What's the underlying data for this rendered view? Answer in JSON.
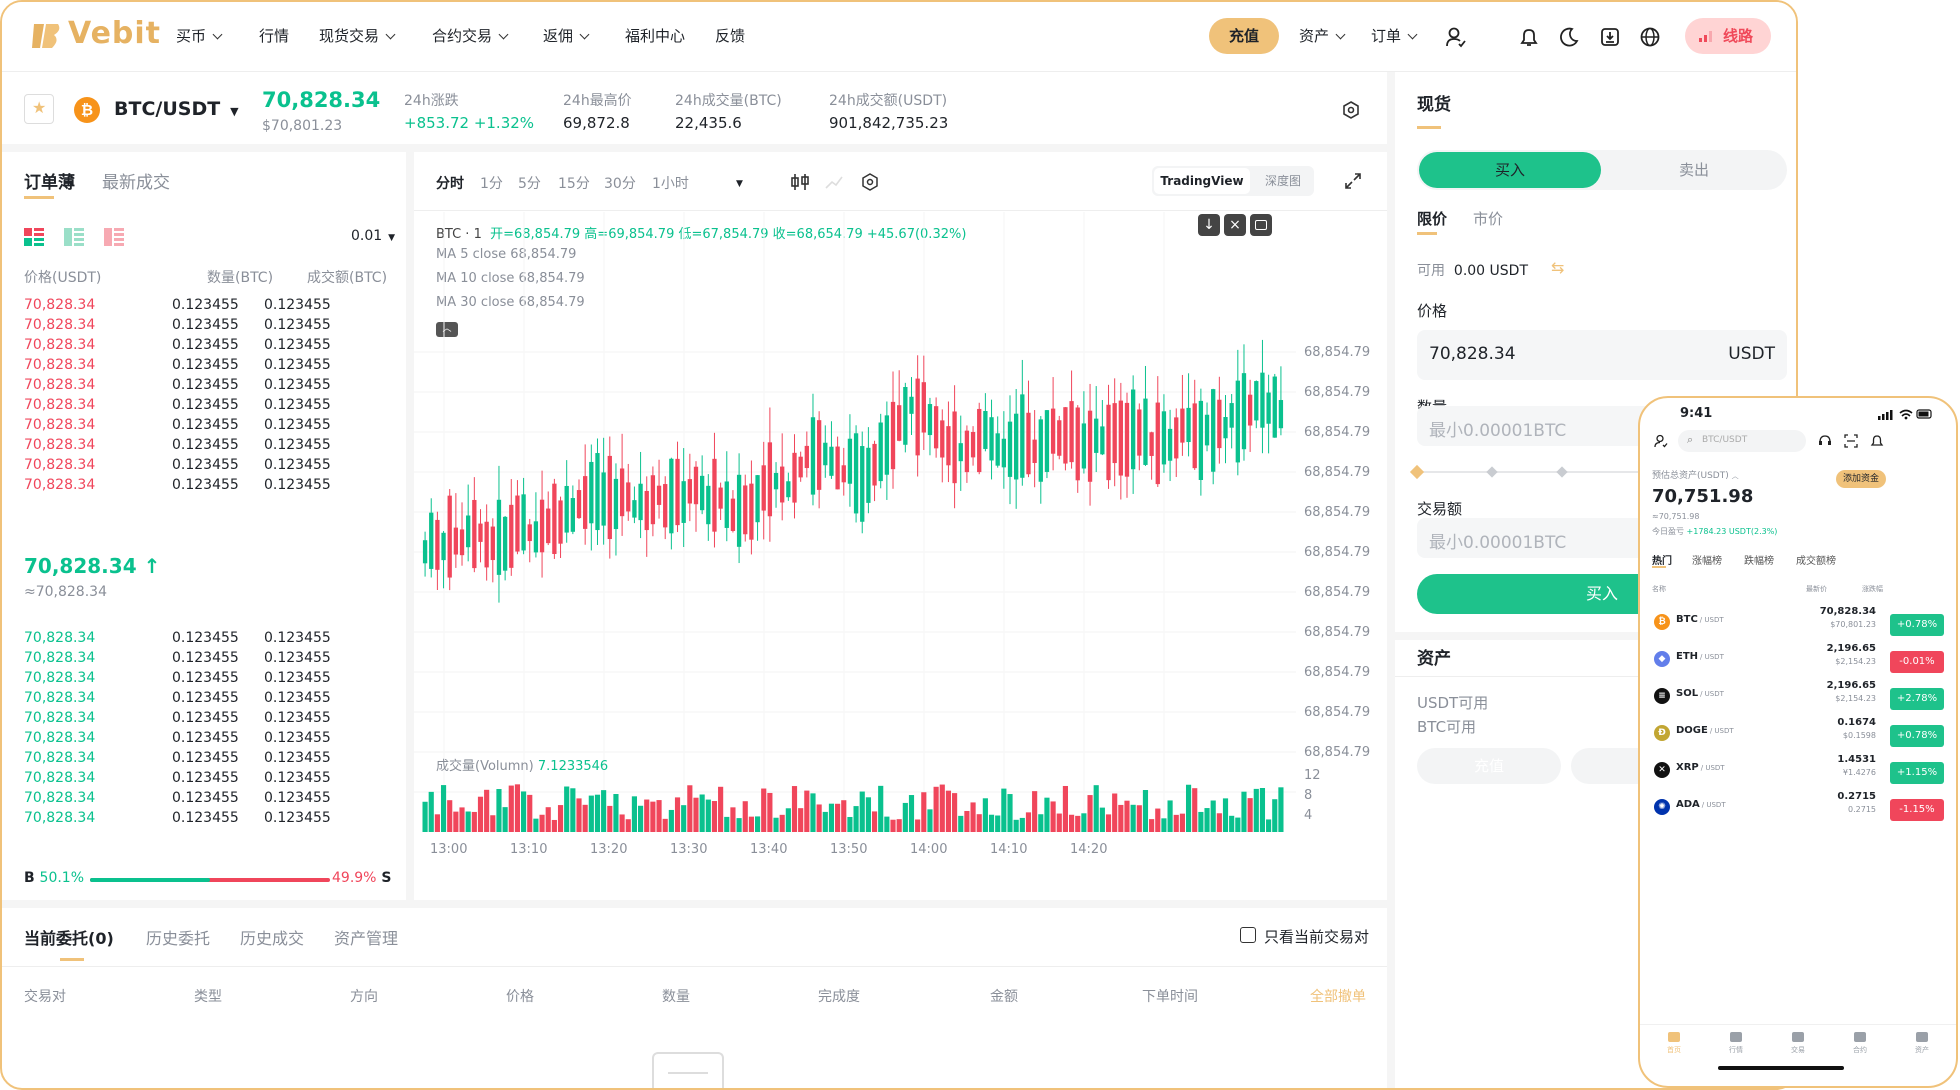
{
  "nav": {
    "logo": "Vebit",
    "items": [
      {
        "label": "买币",
        "dropdown": true
      },
      {
        "label": "行情",
        "dropdown": false
      },
      {
        "label": "现货交易",
        "dropdown": true
      },
      {
        "label": "合约交易",
        "dropdown": true
      },
      {
        "label": "返佣",
        "dropdown": true
      },
      {
        "label": "福利中心",
        "dropdown": false
      },
      {
        "label": "反馈",
        "dropdown": false
      }
    ],
    "deposit": "充值",
    "assets": "资产",
    "orders": "订单",
    "line": "线路"
  },
  "ticker": {
    "pair": "BTC/USDT",
    "coin_glyph": "₿",
    "price": "70,828.34",
    "price_sub": "$70,801.23",
    "stats": [
      {
        "label": "24h涨跌",
        "value": "+853.72 +1.32%",
        "color": "green"
      },
      {
        "label": "24h最高价",
        "value": "69,872.8",
        "color": "dark"
      },
      {
        "label": "24h成交量(BTC)",
        "value": "22,435.6",
        "color": "dark"
      },
      {
        "label": "24h成交额(USDT)",
        "value": "901,842,735.23",
        "color": "dark"
      }
    ]
  },
  "orderbook": {
    "tabs": [
      "订单薄",
      "最新成交"
    ],
    "precision": "0.01",
    "headers": [
      "价格(USDT)",
      "数量(BTC)",
      "成交额(BTC)"
    ],
    "asks": [
      [
        "70,828.34",
        "0.123455",
        "0.123455"
      ],
      [
        "70,828.34",
        "0.123455",
        "0.123455"
      ],
      [
        "70,828.34",
        "0.123455",
        "0.123455"
      ],
      [
        "70,828.34",
        "0.123455",
        "0.123455"
      ],
      [
        "70,828.34",
        "0.123455",
        "0.123455"
      ],
      [
        "70,828.34",
        "0.123455",
        "0.123455"
      ],
      [
        "70,828.34",
        "0.123455",
        "0.123455"
      ],
      [
        "70,828.34",
        "0.123455",
        "0.123455"
      ],
      [
        "70,828.34",
        "0.123455",
        "0.123455"
      ],
      [
        "70,828.34",
        "0.123455",
        "0.123455"
      ]
    ],
    "mid_price": "70,828.34 ↑",
    "mid_sub": "≈70,828.34",
    "bids": [
      [
        "70,828.34",
        "0.123455",
        "0.123455"
      ],
      [
        "70,828.34",
        "0.123455",
        "0.123455"
      ],
      [
        "70,828.34",
        "0.123455",
        "0.123455"
      ],
      [
        "70,828.34",
        "0.123455",
        "0.123455"
      ],
      [
        "70,828.34",
        "0.123455",
        "0.123455"
      ],
      [
        "70,828.34",
        "0.123455",
        "0.123455"
      ],
      [
        "70,828.34",
        "0.123455",
        "0.123455"
      ],
      [
        "70,828.34",
        "0.123455",
        "0.123455"
      ],
      [
        "70,828.34",
        "0.123455",
        "0.123455"
      ],
      [
        "70,828.34",
        "0.123455",
        "0.123455"
      ]
    ],
    "buy_label": "B",
    "buy_pct": "50.1%",
    "sell_pct": "49.9%",
    "sell_label": "S",
    "buy_ratio": 0.501
  },
  "chart": {
    "intervals": [
      "分时",
      "1分",
      "5分",
      "15分",
      "30分",
      "1小时"
    ],
    "view_tabs": [
      "TradingView",
      "深度图"
    ],
    "info_prefix": "BTC · 1",
    "ohlc": "开=68,854.79  高=69,854.79  低=67,854.79  收=68,654.79  +45.67(0.32%)",
    "ma": [
      "MA 5 close 68,854.79",
      "MA 10 close 68,854.79",
      "MA 30 close 68,854.79"
    ],
    "volume_label": "成交量(Volumn)",
    "volume_value": "7.1233546",
    "y_ticks": [
      "68,854.79",
      "68,854.79",
      "68,854.79",
      "68,854.79",
      "68,854.79",
      "68,854.79",
      "68,854.79",
      "68,854.79",
      "68,854.79",
      "68,854.79",
      "68,854.79"
    ],
    "vol_ticks": [
      "12",
      "8",
      "4"
    ],
    "x_ticks": [
      "13:00",
      "13:10",
      "13:20",
      "13:30",
      "13:40",
      "13:50",
      "14:00",
      "14:10",
      "14:20"
    ],
    "up_color": "#0ac18e",
    "down_color": "#f0465b"
  },
  "orders": {
    "tabs": [
      "当前委托(0)",
      "历史委托",
      "历史成交",
      "资产管理"
    ],
    "only_current": "只看当前交易对",
    "columns": [
      "交易对",
      "类型",
      "方向",
      "价格",
      "数量",
      "完成度",
      "金额",
      "下单时间"
    ],
    "cancel_all": "全部撤单"
  },
  "trade": {
    "title": "现货",
    "buy": "买入",
    "sell": "卖出",
    "types": [
      "限价",
      "市价"
    ],
    "available_label": "可用",
    "available_value": "0.00 USDT",
    "price_label": "价格",
    "price_value": "70,828.34",
    "price_unit": "USDT",
    "qty_label": "数量",
    "qty_placeholder": "最小0.00001BTC",
    "amount_label": "交易额",
    "amount_placeholder": "最小0.00001BTC",
    "submit": "买入",
    "assets_title": "资产",
    "usdt_available": "USDT可用",
    "btc_available": "BTC可用",
    "deposit": "充值"
  },
  "phone": {
    "time": "9:41",
    "search_placeholder": "BTC/USDT",
    "total_label": "预估总资产(USDT)",
    "add_funds": "添加资金",
    "total": "70,751.98",
    "total_sub": "≈70,751.98",
    "pnl_label": "今日盈亏",
    "pnl_value": "+1784.23 USDT(2.3%)",
    "tabs": [
      "热门",
      "涨幅榜",
      "跌幅榜",
      "成交额榜"
    ],
    "col_name": "名称",
    "col_price": "最新价",
    "col_change": "涨跌幅",
    "coins": [
      {
        "sym": "BTC",
        "quote": "/ USDT",
        "price": "70,828.34",
        "sub": "$70,801.23",
        "change": "+0.78%",
        "up": true,
        "color": "#f7931a",
        "glyph": "₿"
      },
      {
        "sym": "ETH",
        "quote": "/ USDT",
        "price": "2,196.65",
        "sub": "$2,154.23",
        "change": "-0.01%",
        "up": false,
        "color": "#627eea",
        "glyph": "◆"
      },
      {
        "sym": "SOL",
        "quote": "/ USDT",
        "price": "2,196.65",
        "sub": "$2,154.23",
        "change": "+2.78%",
        "up": true,
        "color": "#111111",
        "glyph": "≡"
      },
      {
        "sym": "DOGE",
        "quote": "/ USDT",
        "price": "0.1674",
        "sub": "$0.1598",
        "change": "+0.78%",
        "up": true,
        "color": "#c2a633",
        "glyph": "Ð"
      },
      {
        "sym": "XRP",
        "quote": "/ USDT",
        "price": "1.4531",
        "sub": "¥1.4276",
        "change": "+1.15%",
        "up": true,
        "color": "#111111",
        "glyph": "✕"
      },
      {
        "sym": "ADA",
        "quote": "/ USDT",
        "price": "0.2715",
        "sub": "0.2715",
        "change": "-1.15%",
        "up": false,
        "color": "#0033ad",
        "glyph": "✺"
      }
    ],
    "bottom_nav": [
      "首页",
      "行情",
      "交易",
      "合约",
      "资产"
    ]
  }
}
